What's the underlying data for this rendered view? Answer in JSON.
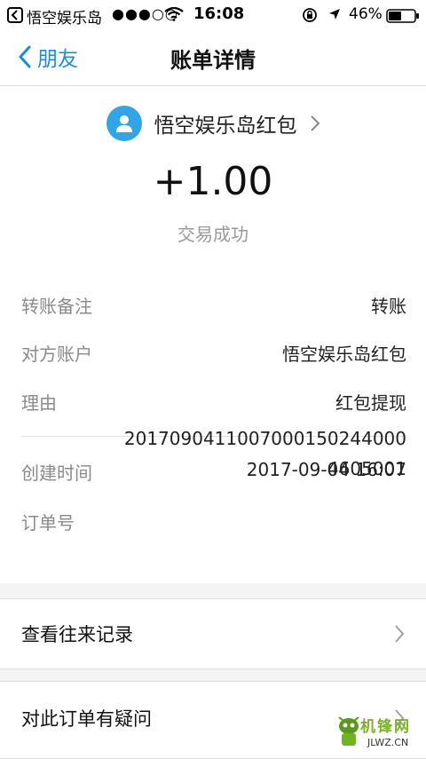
{
  "status_bar": {
    "app": "悟空娱乐岛",
    "signal": "●●●○○",
    "time": "16:08",
    "battery": "46%"
  },
  "nav": {
    "back_label": "朋友",
    "title": "账单详情"
  },
  "transaction": {
    "counterparty": "悟空娱乐岛红包",
    "amount": "+1.00",
    "status": "交易成功"
  },
  "details": [
    {
      "label": "转账备注",
      "value": "转账"
    },
    {
      "label": "对方账户",
      "value": "悟空娱乐岛红包"
    },
    {
      "label": "理由",
      "value": "红包提现"
    },
    {
      "label": "创建时间",
      "value": "2017-09-04 16:07"
    },
    {
      "label": "订单号",
      "value": "2017090411007000150244000460 5001"
    }
  ],
  "order_number": "20170904110070001502440004605001",
  "actions": {
    "history": "查看往来记录",
    "question": "对此订单有疑问"
  },
  "watermark": {
    "text": "机锋网",
    "site": "JLWZ.CN"
  },
  "colors": {
    "accent": "#1a8ce0",
    "avatar": "#32a5e6"
  }
}
